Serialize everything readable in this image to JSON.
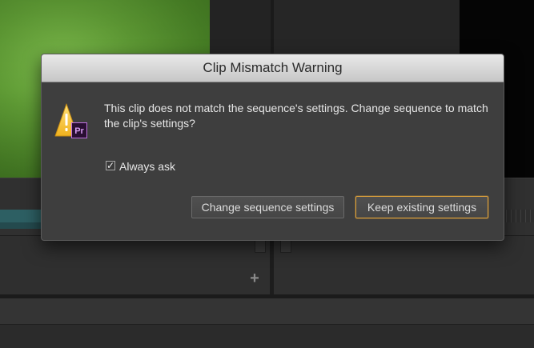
{
  "dialog": {
    "title": "Clip Mismatch Warning",
    "message": "This clip does not match the sequence's settings. Change sequence to match the clip's settings?",
    "checkbox": {
      "label": "Always ask",
      "checked": true,
      "check_glyph": "✓"
    },
    "buttons": {
      "change_label": "Change sequence settings",
      "keep_label": "Keep existing settings"
    },
    "icon": {
      "name": "warning-icon",
      "badge_text": "Pr",
      "badge_color": "#c071e0",
      "warning_color": "#f6c343"
    }
  },
  "timeline": {
    "add_glyph": "+"
  },
  "colors": {
    "accent_focus": "#e0a23a",
    "dialog_bg": "#3e3e3e"
  }
}
